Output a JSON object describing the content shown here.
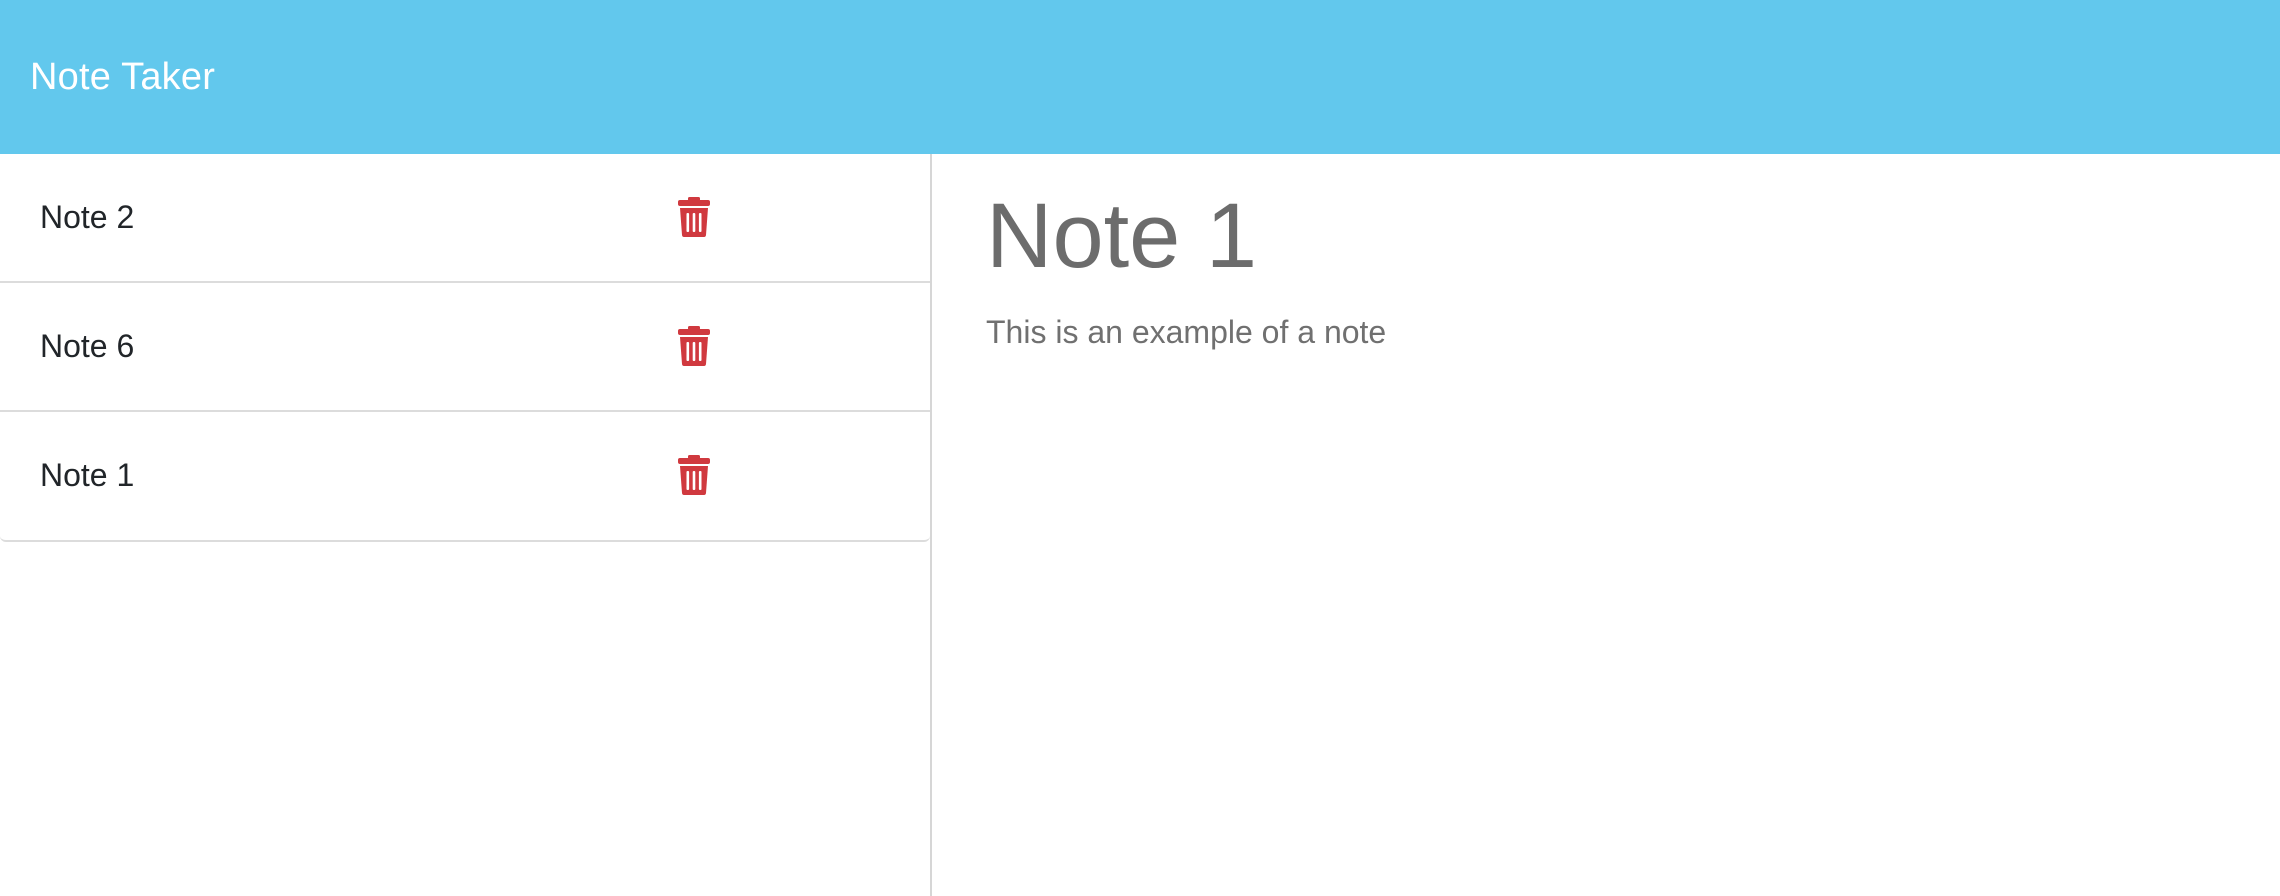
{
  "app": {
    "title": "Note Taker",
    "accent_color": "#62c8ed",
    "delete_color": "#d0393f"
  },
  "notes": [
    {
      "title": "Note 2",
      "delete_icon": "trash-icon"
    },
    {
      "title": "Note 6",
      "delete_icon": "trash-icon"
    },
    {
      "title": "Note 1",
      "delete_icon": "trash-icon"
    }
  ],
  "active_note": {
    "title": "Note 1",
    "text": "This is an example of a note"
  }
}
